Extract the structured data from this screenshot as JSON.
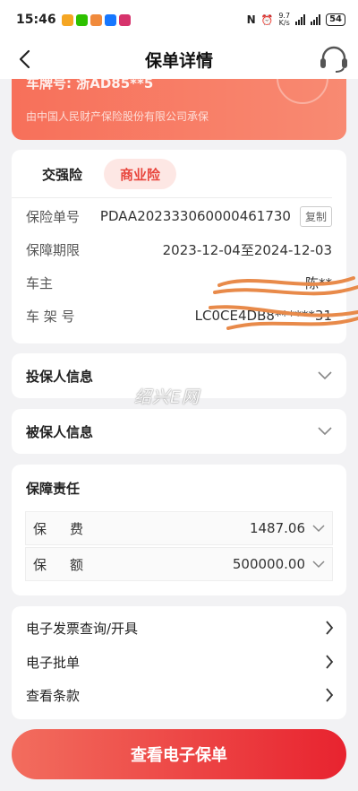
{
  "status_bar": {
    "time": "15:46",
    "net_speed_value": "9.7",
    "net_speed_unit": "K/s",
    "battery": "54"
  },
  "nav": {
    "title": "保单详情",
    "back_icon": "chevron-left-icon",
    "service_icon": "headset-icon"
  },
  "banner": {
    "plate": "车牌号: 浙AD85**5",
    "insurer": "由中国人民财产保险股份有限公司承保",
    "bg_color": "#f7705a"
  },
  "policy": {
    "tabs": [
      {
        "label": "交强险",
        "active": false
      },
      {
        "label": "商业险",
        "active": true
      }
    ],
    "rows": [
      {
        "label": "保险单号",
        "value": "PDAA202333060000461730",
        "action": "复制"
      },
      {
        "label": "保障期限",
        "value": "2023-12-04至2024-12-03"
      },
      {
        "label": "车主",
        "value": "陈**"
      },
      {
        "label": "车 架 号",
        "value": "LC0CE4DB8******31"
      }
    ]
  },
  "sections": {
    "policyholder": "投保人信息",
    "insured": "被保人信息"
  },
  "coverage": {
    "title": "保障责任",
    "rows": [
      {
        "label": "保费",
        "value": "1487.06"
      },
      {
        "label": "保额",
        "value": "500000.00"
      }
    ]
  },
  "links": [
    {
      "label": "电子发票查询/开具"
    },
    {
      "label": "电子批单"
    },
    {
      "label": "查看条款"
    }
  ],
  "primary_button": "查看电子保单",
  "watermark": "绍兴E网",
  "colors": {
    "accent": "#e8453c",
    "button_start": "#f26d5e",
    "button_end": "#e8232f",
    "redaction": "#e88a4a"
  }
}
